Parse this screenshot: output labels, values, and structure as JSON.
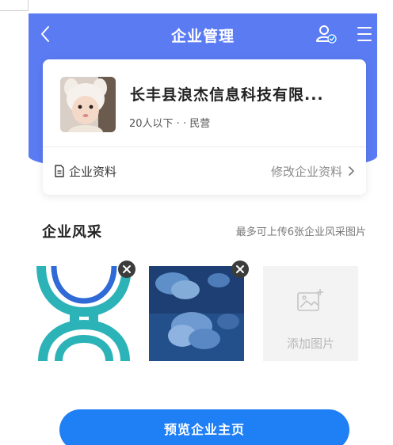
{
  "navbar": {
    "title": "企业管理",
    "back_icon": "chevron-left-icon",
    "user_icon": "verified-user-icon",
    "menu_icon": "menu-icon"
  },
  "company": {
    "name": "长丰县浪杰信息科技有限...",
    "meta": "20人以下 · · 民营",
    "info_label": "企业资料",
    "edit_label": "修改企业资料"
  },
  "gallery": {
    "title": "企业风采",
    "hint": "最多可上传6张企业风采图片",
    "add_label": "添加图片"
  },
  "preview_button": "预览企业主页",
  "colors": {
    "header_blue": "#5b7bf3",
    "button_blue": "#1f7ff5",
    "logo_teal": "#2bb3b8",
    "logo_blue": "#2f6ad6"
  }
}
